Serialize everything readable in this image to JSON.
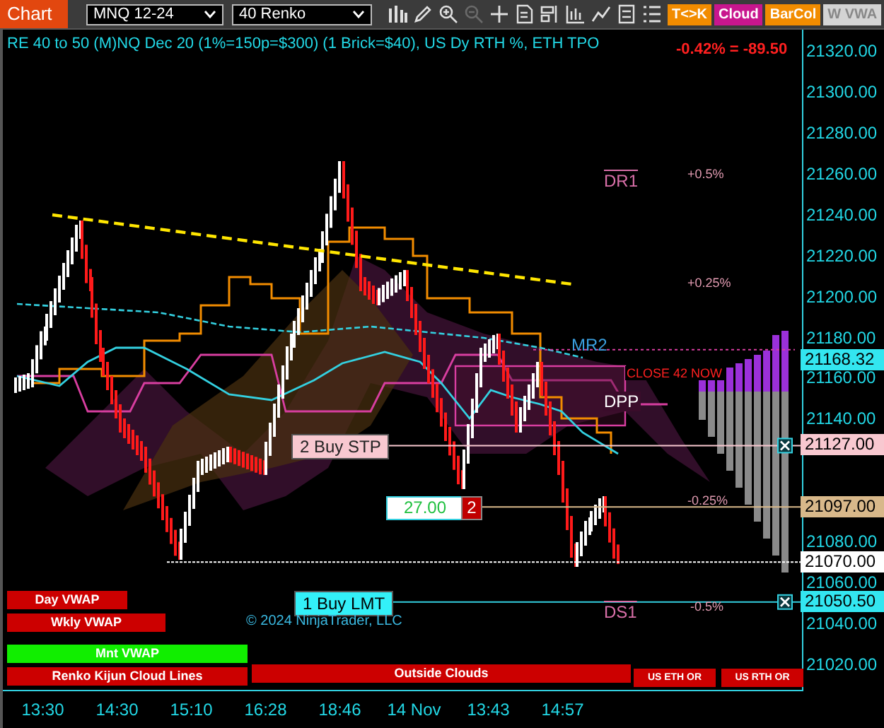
{
  "toolbar": {
    "title": "Chart",
    "instrument": "MNQ 12-24",
    "bar_type": "40 Renko",
    "tools": [
      {
        "kind": "bars",
        "disabled": false
      },
      {
        "kind": "pencil",
        "disabled": false
      },
      {
        "kind": "zoom-in",
        "disabled": false
      },
      {
        "kind": "zoom-out",
        "disabled": true
      },
      {
        "kind": "crosshair",
        "disabled": false
      },
      {
        "kind": "doc",
        "disabled": false
      },
      {
        "kind": "panel",
        "disabled": false
      },
      {
        "kind": "chart",
        "disabled": false
      },
      {
        "kind": "line",
        "disabled": false
      },
      {
        "kind": "grid",
        "disabled": false
      },
      {
        "kind": "list",
        "disabled": false
      }
    ],
    "tags": [
      {
        "label": "T<>K",
        "color": "#f28c00"
      },
      {
        "label": "Cloud",
        "color": "#c8168e"
      },
      {
        "label": "BarCol",
        "color": "#f28c00"
      },
      {
        "label": "W VWA",
        "color": "#d4d4d4"
      }
    ]
  },
  "chart": {
    "heading": "RE 40 to 50 (M)NQ Dec 20 (1%=150p=$300) (1 Brick=$40), US Dy RTH %, ETH TPO",
    "change": "-0.42% = -89.50",
    "price_axis": [
      "21320.00",
      "21300.00",
      "21280.00",
      "21260.00",
      "21240.00",
      "21220.00",
      "21200.00",
      "21180.00",
      "21160.00",
      "21140.00",
      "21080.00",
      "21060.00",
      "21040.00",
      "21020.00"
    ],
    "price_tags": [
      {
        "label": "21168.32",
        "color": "#33e6f0"
      },
      {
        "label": "21127.00",
        "color": "#f8c8d0"
      },
      {
        "label": "21097.00",
        "color": "#d8b88a"
      },
      {
        "label": "21070.00",
        "color": "#ffffff"
      },
      {
        "label": "21050.50",
        "color": "#33e6f0"
      }
    ],
    "orders": [
      {
        "label": "2 Buy STP",
        "kind": "stop"
      },
      {
        "label": "1 Buy LMT",
        "kind": "limit"
      }
    ],
    "position": {
      "price": "27.00",
      "quantity": "2"
    },
    "levels": [
      {
        "label": "DR1",
        "kind": "pivot"
      },
      {
        "label": "+0.5%",
        "kind": "percent"
      },
      {
        "label": "+0.25%",
        "kind": "percent"
      },
      {
        "label": "MR2",
        "kind": "mid"
      },
      {
        "label": "DPP",
        "kind": "center"
      },
      {
        "label": "CLOSE 42 NOW",
        "kind": "alert"
      },
      {
        "label": "-0.25%",
        "kind": "percent"
      },
      {
        "label": "DS1",
        "kind": "pivot"
      },
      {
        "label": "-0.5%",
        "kind": "percent"
      }
    ],
    "legend": [
      {
        "label": "Day VWAP",
        "color": "#cc0000"
      },
      {
        "label": "Wkly VWAP",
        "color": "#cc0000"
      },
      {
        "label": "Mnt VWAP",
        "color": "#11ee00"
      },
      {
        "label": "Renko Kijun Cloud Lines",
        "color": "#cc0000"
      },
      {
        "label": "Outside Clouds",
        "color": "#cc0000"
      },
      {
        "label": "US ETH OR",
        "color": "#cc0000"
      },
      {
        "label": "US RTH OR",
        "color": "#cc0000"
      }
    ],
    "copyright": "© 2024 NinjaTrader, LLC",
    "time_axis": [
      "13:30",
      "14:30",
      "15:10",
      "16:28",
      "18:46",
      "14 Nov",
      "13:43",
      "14:57"
    ]
  }
}
